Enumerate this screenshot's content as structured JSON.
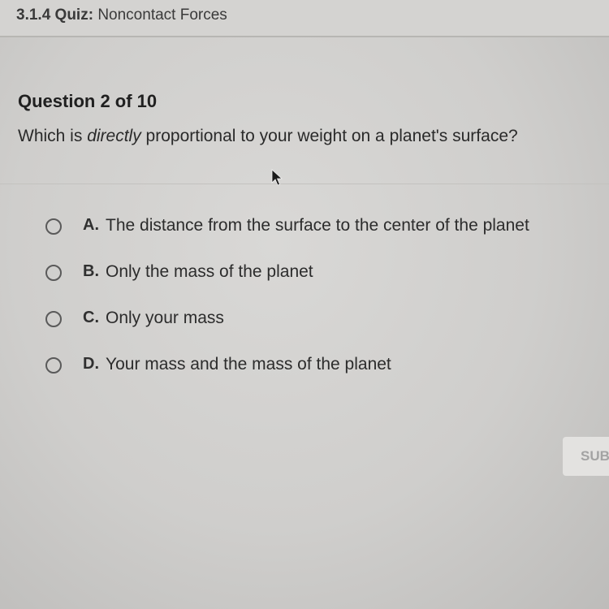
{
  "header": {
    "quiz_id": "3.1.4",
    "quiz_kind": "Quiz:",
    "quiz_name": "Noncontact Forces"
  },
  "question": {
    "number_label": "Question 2 of 10",
    "text_before": "Which is ",
    "text_emphasis": "directly",
    "text_after": " proportional to your weight on a planet's surface?"
  },
  "options": [
    {
      "letter": "A.",
      "text": "The distance from the surface to the center of the planet"
    },
    {
      "letter": "B.",
      "text": "Only the mass of the planet"
    },
    {
      "letter": "C.",
      "text": "Only your mass"
    },
    {
      "letter": "D.",
      "text": "Your mass and the mass of the planet"
    }
  ],
  "submit": {
    "label": "SUB"
  },
  "icons": {
    "cursor": "mouse-pointer-icon"
  },
  "colors": {
    "background": "#d9d8d6",
    "header": "#d4d3d1",
    "submit_bg": "#e3e2e0",
    "submit_text": "#a3a3a3"
  }
}
